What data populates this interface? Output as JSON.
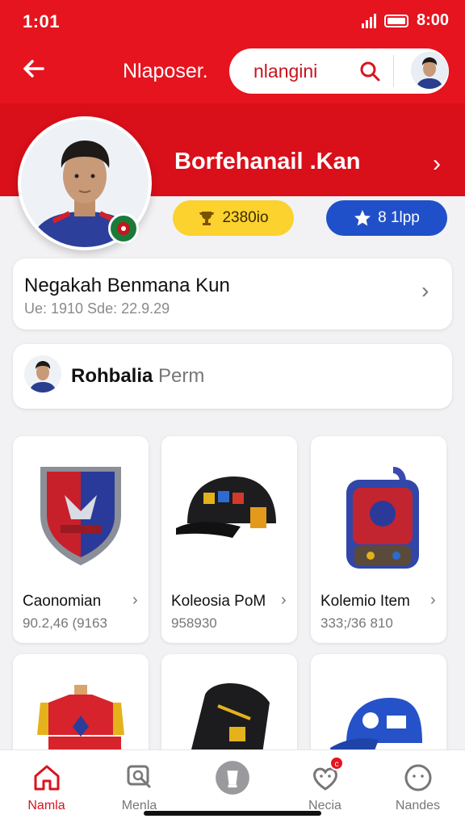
{
  "status_bar": {
    "time": "1:01",
    "right_text": "8:00"
  },
  "header": {
    "title": "Nlaposer.",
    "search_value": "nlangini"
  },
  "profile": {
    "name": "Borfehanail .Kan",
    "stat_coins": "2380io",
    "stat_rating": "8 1lpp"
  },
  "account_card": {
    "title": "Negakah Benmana Kun",
    "subtitle": "Ue: 1910 Sde: 22.9.29"
  },
  "profile_row": {
    "name": "Rohbalia",
    "suffix": "Perm"
  },
  "grid": [
    {
      "label": "Caonomian",
      "meta": "90.2,46 (9163",
      "icon": "club-crest-icon"
    },
    {
      "label": "Koleosia PoM",
      "meta": "958930",
      "icon": "cap-icon"
    },
    {
      "label": "Kolemio Item",
      "meta": "333;/36 810",
      "icon": "backpack-icon"
    },
    {
      "label": "",
      "meta": "",
      "icon": "jersey-icon"
    },
    {
      "label": "",
      "meta": "",
      "icon": "bag-icon"
    },
    {
      "label": "",
      "meta": "",
      "icon": "blue-cap-icon"
    }
  ],
  "bottom_nav": [
    {
      "label": "Namla",
      "icon": "home-icon",
      "active": true
    },
    {
      "label": "Menla",
      "icon": "chat-search-icon",
      "active": false
    },
    {
      "label": "",
      "icon": "center-icon",
      "active": false
    },
    {
      "label": "Necia",
      "icon": "heart-face-icon",
      "active": false,
      "badge": "c"
    },
    {
      "label": "Nandes",
      "icon": "emoji-icon",
      "active": false
    }
  ],
  "colors": {
    "brand_red": "#e5141f",
    "yellow": "#fbd22e",
    "blue": "#2050c9"
  }
}
